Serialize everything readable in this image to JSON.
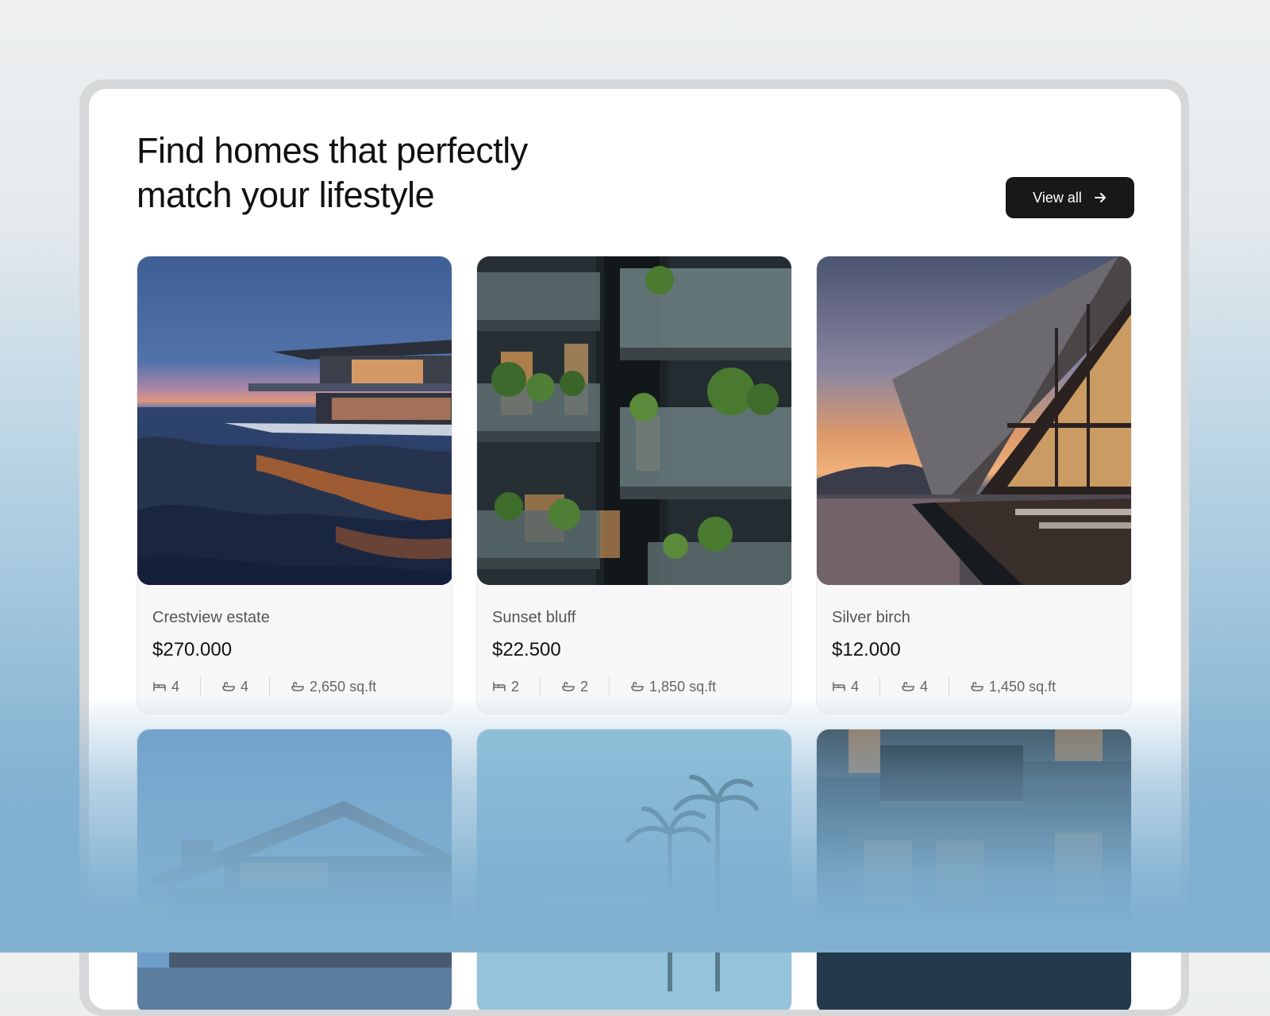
{
  "header": {
    "title_line1": "Find homes that perfectly",
    "title_line2": "match your lifestyle",
    "view_all_label": "View all",
    "view_all_icon": "arrow-right-icon"
  },
  "listings": [
    {
      "name": "Crestview estate",
      "price": "$270.000",
      "beds": "4",
      "baths": "4",
      "area": "2,650 sq.ft"
    },
    {
      "name": "Sunset bluff",
      "price": "$22.500",
      "beds": "2",
      "baths": "2",
      "area": "1,850 sq.ft"
    },
    {
      "name": "Silver birch",
      "price": "$12.000",
      "beds": "4",
      "baths": "4",
      "area": "1,450 sq.ft"
    }
  ],
  "icons": {
    "beds": "bed-icon",
    "baths": "bath-icon",
    "area": "area-icon"
  },
  "colors": {
    "button_bg": "#16181a",
    "card_bg": "#f7f7f8",
    "page_bg_bottom": "#7fb0d0"
  }
}
